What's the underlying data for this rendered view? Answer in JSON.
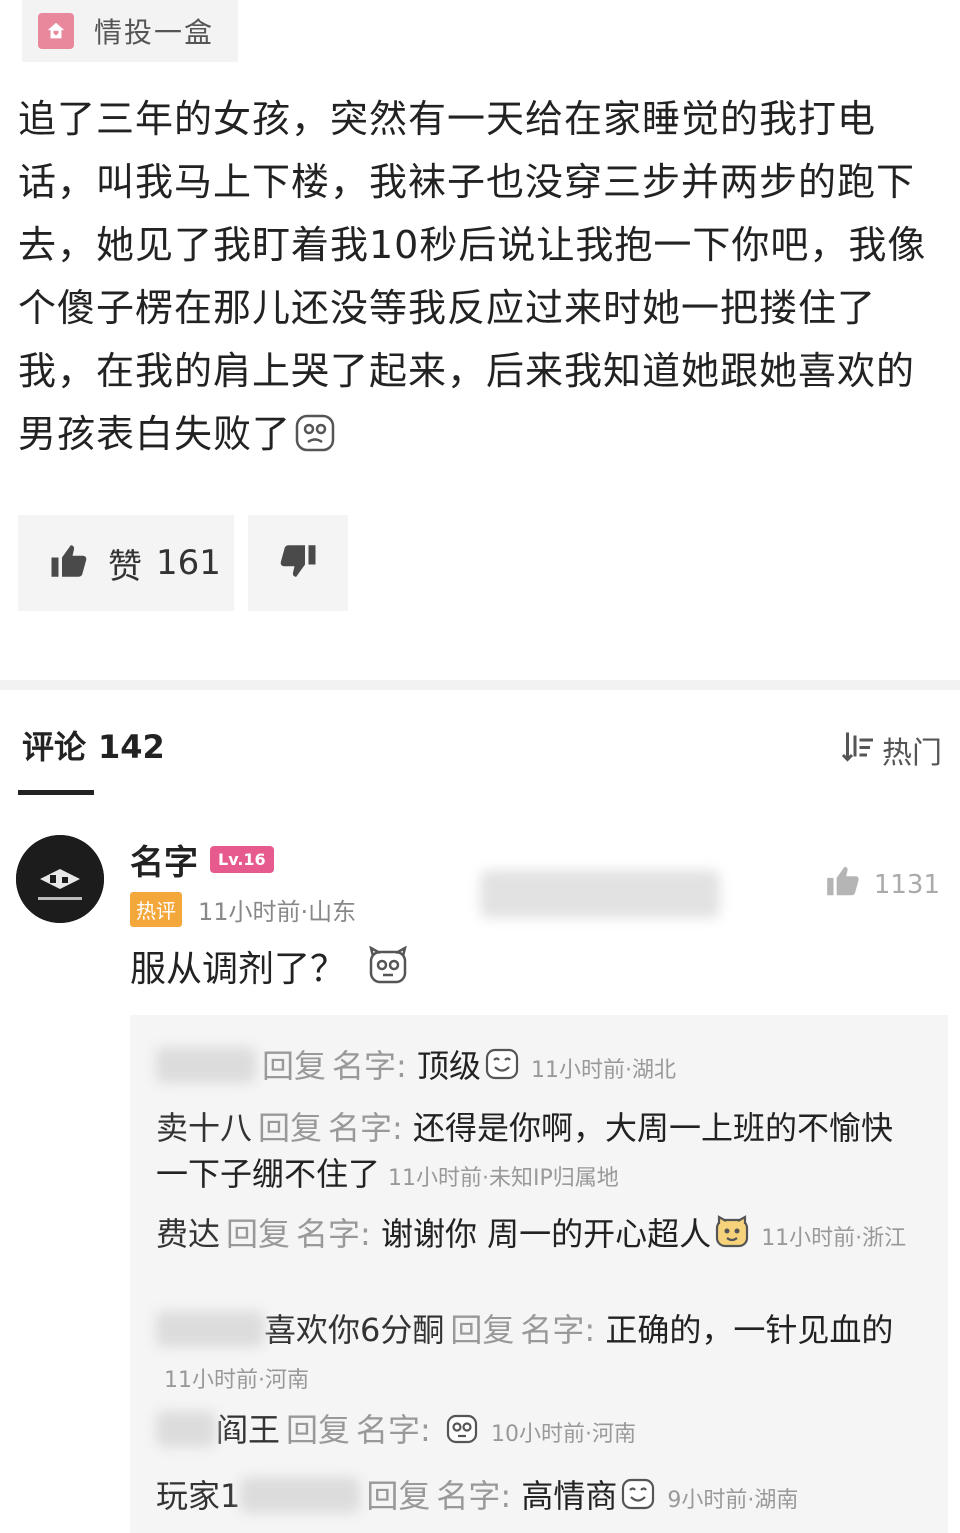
{
  "source": {
    "name": "情投一盒",
    "logo_icon": "house-heart-icon"
  },
  "post": {
    "text": "追了三年的女孩，突然有一天给在家睡觉的我打电话，叫我马上下楼，我袜子也没穿三步并两步的跑下去，她见了我盯着我10秒后说让我抱一下你吧，我像个傻子楞在那儿还没等我反应过来时她一把搂住了我，在我的肩上哭了起来，后来我知道她跟她喜欢的男孩表白失败了",
    "emoji": "sad-face-emoji"
  },
  "actions": {
    "like_label": "赞",
    "like_count": "161"
  },
  "comments": {
    "title": "评论",
    "count": "142",
    "sort_label": "热门"
  },
  "main_comment": {
    "user": "名字",
    "level": "Lv.16",
    "hot_badge": "热评",
    "meta": "11小时前·山东",
    "likes": "1131",
    "text": "服从调剂了？"
  },
  "replies": [
    {
      "nick": "",
      "reply_word": "回复",
      "target": "名字:",
      "text": "顶级",
      "time": "11小时前·湖北"
    },
    {
      "nick": "卖十八",
      "reply_word": "回复",
      "target": "名字:",
      "text": "还得是你啊，大周一上班的不愉快一下子绷不住了",
      "time": "11小时前·未知IP归属地"
    },
    {
      "nick": "费达",
      "reply_word": "回复",
      "target": "名字:",
      "text": "谢谢你 周一的开心超人",
      "time": "11小时前·浙江"
    },
    {
      "nick": "喜欢你6分酮",
      "reply_word": "回复",
      "target": "名字:",
      "text": "正确的，一针见血的",
      "time": "11小时前·河南"
    },
    {
      "nick": "阎王",
      "reply_word": "回复",
      "target": "名字:",
      "text": "",
      "time": "10小时前·河南"
    },
    {
      "nick": "玩家1",
      "reply_word": "回复",
      "target": "名字:",
      "text": "高情商",
      "time": "9小时前·湖南"
    }
  ]
}
